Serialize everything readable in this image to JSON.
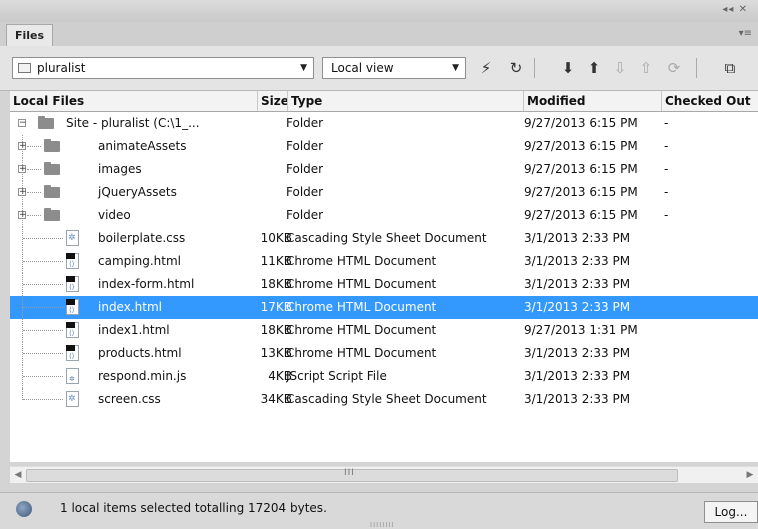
{
  "panel": {
    "collapse_glyph": "◂◂ ✕",
    "tab_label": "Files",
    "menu_glyph": "▾≡"
  },
  "toolbar": {
    "site_value": "pluralist",
    "view_value": "Local view",
    "dropdown_glyph": "▼",
    "buttons": [
      {
        "name": "disconnect-icon",
        "glyph": "⚡"
      },
      {
        "name": "refresh-icon",
        "glyph": "↻"
      },
      {
        "name": "get-files-icon",
        "glyph": "⬇"
      },
      {
        "name": "put-files-icon",
        "glyph": "⬆"
      },
      {
        "name": "check-out-icon",
        "glyph": "⇩"
      },
      {
        "name": "check-in-icon",
        "glyph": "⇧"
      },
      {
        "name": "synchronize-icon",
        "glyph": "⟳"
      },
      {
        "name": "expand-panel-icon",
        "glyph": "⧉"
      }
    ]
  },
  "columns": {
    "name": "Local Files",
    "size": "Size",
    "type": "Type",
    "modified": "Modified",
    "checked_out": "Checked Out"
  },
  "rows": [
    {
      "name": "Site - pluralist (C:\\1_...",
      "size": "",
      "type": "Folder",
      "modified": "9/27/2013 6:15 PM",
      "checked": "-",
      "kind": "root"
    },
    {
      "name": "animateAssets",
      "size": "",
      "type": "Folder",
      "modified": "9/27/2013 6:15 PM",
      "checked": "-",
      "kind": "folder"
    },
    {
      "name": "images",
      "size": "",
      "type": "Folder",
      "modified": "9/27/2013 6:15 PM",
      "checked": "-",
      "kind": "folder"
    },
    {
      "name": "jQueryAssets",
      "size": "",
      "type": "Folder",
      "modified": "9/27/2013 6:15 PM",
      "checked": "-",
      "kind": "folder"
    },
    {
      "name": "video",
      "size": "",
      "type": "Folder",
      "modified": "9/27/2013 6:15 PM",
      "checked": "-",
      "kind": "folder"
    },
    {
      "name": "boilerplate.css",
      "size": "10KB",
      "type": "Cascading Style Sheet Document",
      "modified": "3/1/2013 2:33 PM",
      "checked": "",
      "kind": "css"
    },
    {
      "name": "camping.html",
      "size": "11KB",
      "type": "Chrome HTML Document",
      "modified": "3/1/2013 2:33 PM",
      "checked": "",
      "kind": "html"
    },
    {
      "name": "index-form.html",
      "size": "18KB",
      "type": "Chrome HTML Document",
      "modified": "3/1/2013 2:33 PM",
      "checked": "",
      "kind": "html"
    },
    {
      "name": "index.html",
      "size": "17KB",
      "type": "Chrome HTML Document",
      "modified": "3/1/2013 2:33 PM",
      "checked": "",
      "kind": "html",
      "selected": true
    },
    {
      "name": "index1.html",
      "size": "18KB",
      "type": "Chrome HTML Document",
      "modified": "9/27/2013 1:31 PM",
      "checked": "",
      "kind": "html"
    },
    {
      "name": "products.html",
      "size": "13KB",
      "type": "Chrome HTML Document",
      "modified": "3/1/2013 2:33 PM",
      "checked": "",
      "kind": "html"
    },
    {
      "name": "respond.min.js",
      "size": "4KB",
      "type": "JScript Script File",
      "modified": "3/1/2013 2:33 PM",
      "checked": "",
      "kind": "js"
    },
    {
      "name": "screen.css",
      "size": "34KB",
      "type": "Cascading Style Sheet Document",
      "modified": "3/1/2013 2:33 PM",
      "checked": "",
      "kind": "css"
    }
  ],
  "scrollbar": {
    "left_arrow": "◀",
    "right_arrow": "▶",
    "grip": "III"
  },
  "status": {
    "text": "1 local items selected totalling 17204 bytes.",
    "log_label": "Log...",
    "resize_grip": "IIIIIIII"
  },
  "colors": {
    "selection": "#3399ff"
  }
}
